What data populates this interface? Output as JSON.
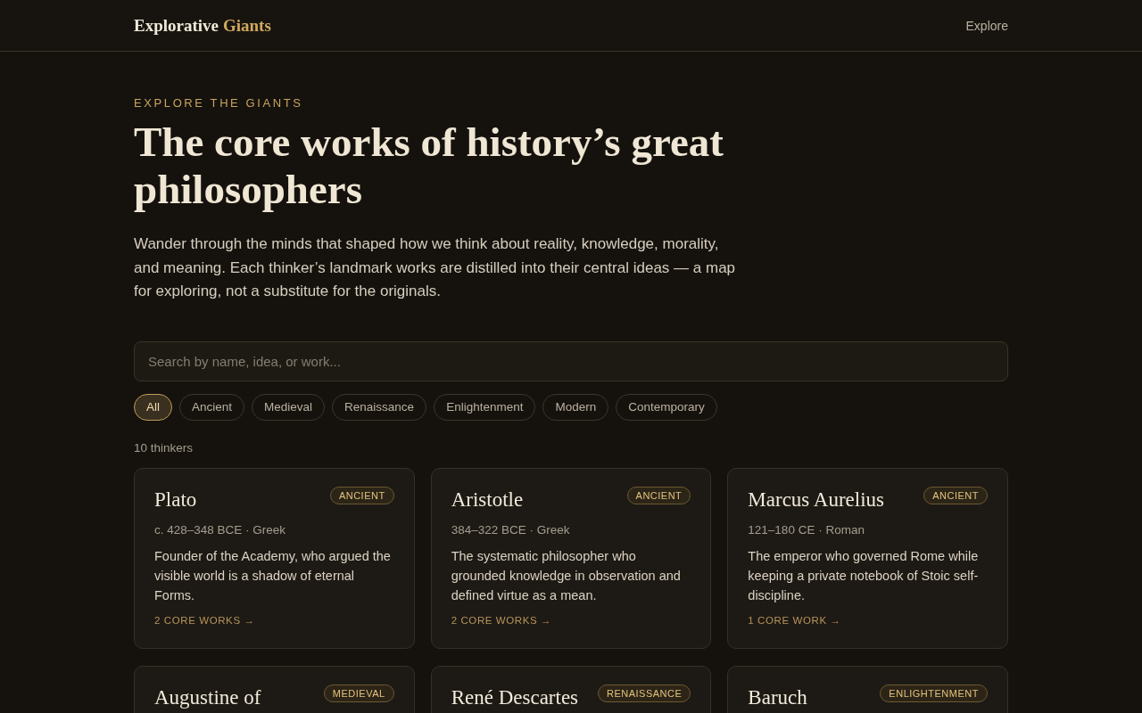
{
  "header": {
    "brand": {
      "first": "Explorative",
      "second": "Giants"
    },
    "nav": [
      "Explore"
    ]
  },
  "hero": {
    "eyebrow": "EXPLORE THE GIANTS",
    "title": "The core works of history’s great philosophers",
    "intro": "Wander through the minds that shaped how we think about reality, knowledge, morality, and meaning. Each thinker’s landmark works are distilled into their central ideas — a map for exploring, not a substitute for the originals."
  },
  "search": {
    "placeholder": "Search by name, idea, or work..."
  },
  "filters": [
    {
      "label": "All",
      "selected": true
    },
    {
      "label": "Ancient",
      "selected": false
    },
    {
      "label": "Medieval",
      "selected": false
    },
    {
      "label": "Renaissance",
      "selected": false
    },
    {
      "label": "Enlightenment",
      "selected": false
    },
    {
      "label": "Modern",
      "selected": false
    },
    {
      "label": "Contemporary",
      "selected": false
    }
  ],
  "count": "10 thinkers",
  "thinkers": [
    {
      "name": "Plato",
      "era": "ANCIENT",
      "meta": "c. 428–348 BCE · Greek",
      "summary": "Founder of the Academy, who argued the visible world is a shadow of eternal Forms.",
      "works": "2 CORE WORKS →"
    },
    {
      "name": "Aristotle",
      "era": "ANCIENT",
      "meta": "384–322 BCE · Greek",
      "summary": "The systematic philosopher who grounded knowledge in observation and defined virtue as a mean.",
      "works": "2 CORE WORKS →"
    },
    {
      "name": "Marcus Aurelius",
      "era": "ANCIENT",
      "meta": "121–180 CE · Roman",
      "summary": "The emperor who governed Rome while keeping a private notebook of Stoic self-discipline.",
      "works": "1 CORE WORK →"
    },
    {
      "name": "Augustine of",
      "era": "MEDIEVAL"
    },
    {
      "name": "René Descartes",
      "era": "RENAISSANCE"
    },
    {
      "name": "Baruch",
      "era": "ENLIGHTENMENT"
    }
  ]
}
